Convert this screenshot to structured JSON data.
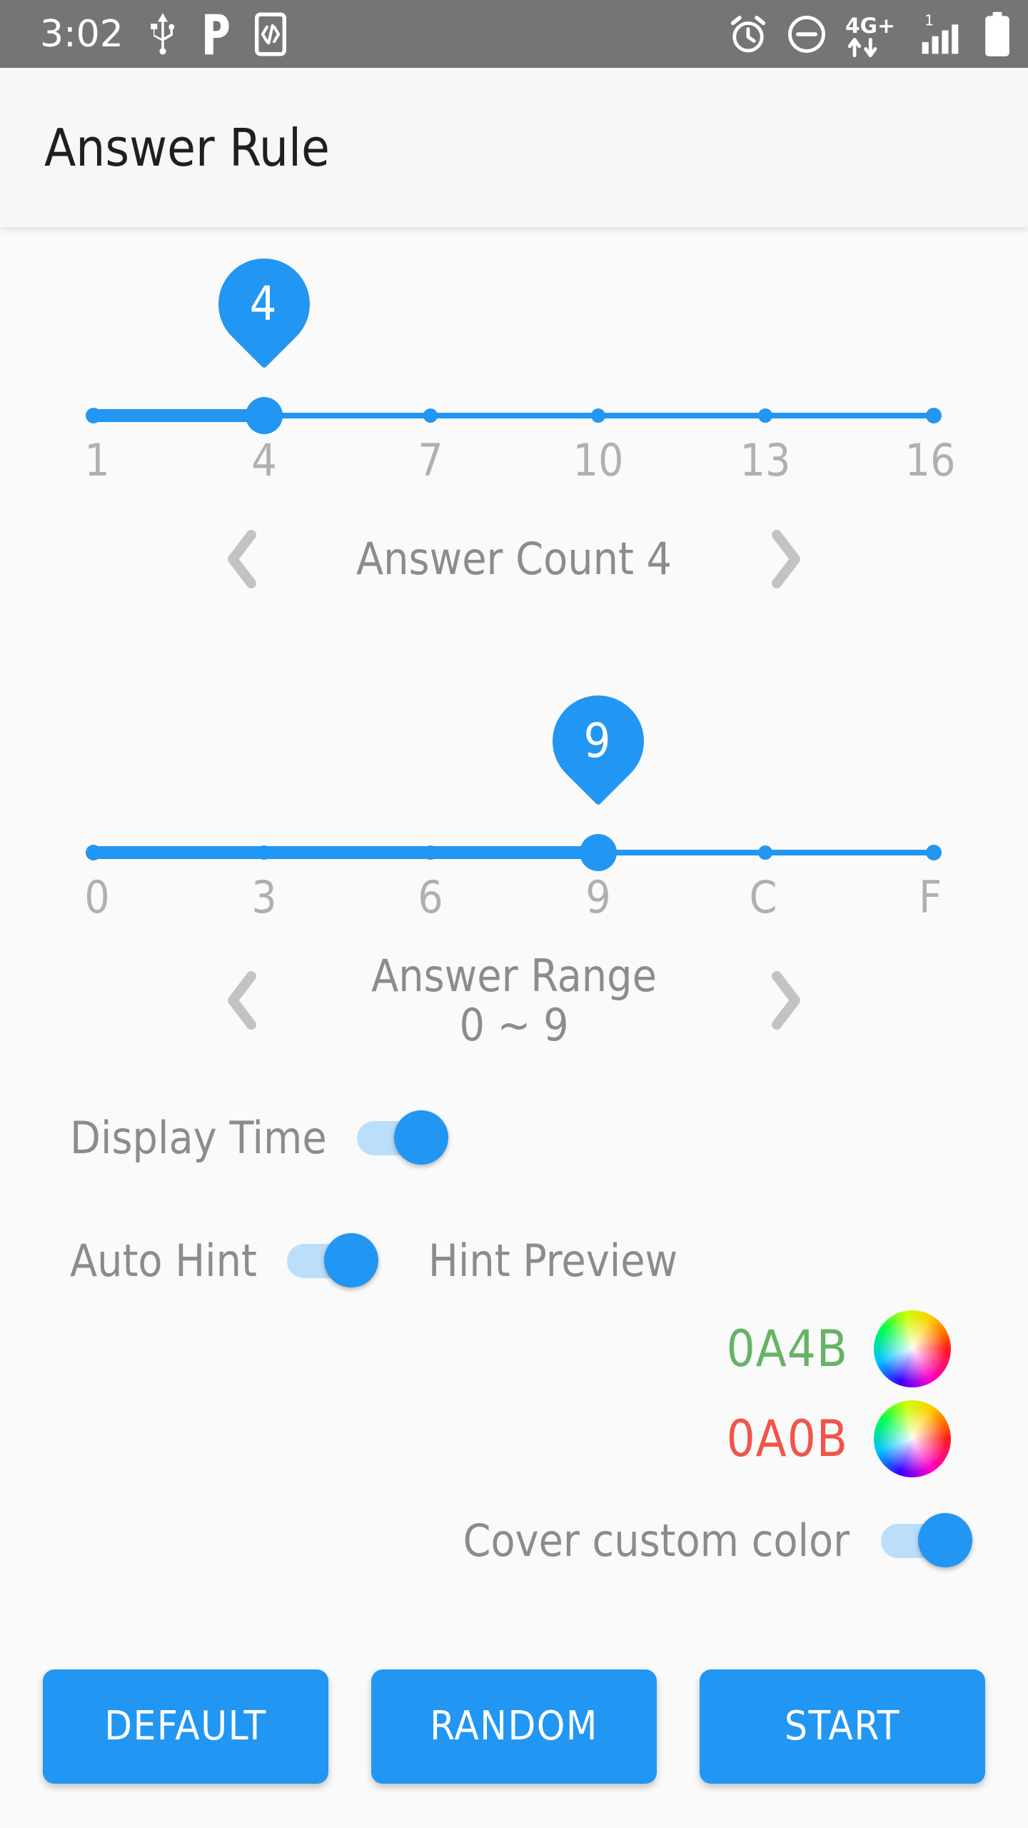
{
  "status_bar": {
    "time": "3:02",
    "left_icons": [
      "usb-icon",
      "pandora-p-icon",
      "developer-code-icon"
    ],
    "right_icons": [
      "alarm-icon",
      "do-not-disturb-icon",
      "network-4g-plus-icon",
      "signal-bars-icon",
      "battery-full-icon"
    ],
    "network_label": "4G+",
    "sim_label": "1",
    "background": "#757575"
  },
  "appbar": {
    "title": "Answer Rule",
    "background": "#f7f7f7"
  },
  "theme": {
    "accent": "#2196f3",
    "track_light": "#bbdefb",
    "label_gray": "#8c8c8c",
    "tick_gray": "#b0b0b0",
    "page_background": "#fafafa"
  },
  "answer_count": {
    "bubble_value": "4",
    "tick_labels": [
      "1",
      "4",
      "7",
      "10",
      "13",
      "16"
    ],
    "value": 4,
    "min": 1,
    "max": 16,
    "step": 3,
    "stepper_label": "Answer Count 4",
    "prev_icon": "chevron-left-icon",
    "next_icon": "chevron-right-icon"
  },
  "answer_range": {
    "bubble_value": "9",
    "tick_labels": [
      "0",
      "3",
      "6",
      "9",
      "C",
      "F"
    ],
    "value": "9",
    "stepper_label_line1": "Answer Range",
    "stepper_label_line2": "0 ~ 9",
    "prev_icon": "chevron-left-icon",
    "next_icon": "chevron-right-icon"
  },
  "display_time": {
    "label": "Display Time",
    "enabled": true
  },
  "auto_hint": {
    "label": "Auto Hint",
    "enabled": true,
    "preview_title": "Hint Preview",
    "previews": [
      {
        "code": "0A4B",
        "color": "#66b366",
        "wheel_icon": "color-wheel-icon"
      },
      {
        "code": "0A0B",
        "color": "#f2544a",
        "wheel_icon": "color-wheel-icon"
      }
    ]
  },
  "cover_custom_color": {
    "label": "Cover custom color",
    "enabled": true
  },
  "buttons": {
    "default": "DEFAULT",
    "random": "RANDOM",
    "start": "START"
  }
}
